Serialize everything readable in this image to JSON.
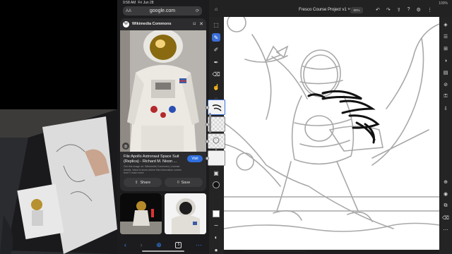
{
  "safari": {
    "status_time": "9:58 AM",
    "status_date": "Fri Jun 28",
    "address": "google.com",
    "address_aa": "AA",
    "source_name": "Wikimedia Commons",
    "result_title": "File:Apollo Astronaut Space Suit (Replica) - Richard M. Nixon ...",
    "result_subtitle": "Get this image on: Wikimedia Commons | License details. Want to know where this information comes from? Learn more",
    "visit_label": "Visit",
    "share_label": "Share",
    "save_label": "Save",
    "tab_count": "5",
    "icons": [
      "back-icon",
      "forward-icon",
      "add-icon",
      "tabs-icon",
      "more-icon"
    ]
  },
  "fresco": {
    "document_title": "Fresco Course Project v1 ˅",
    "zoom_label": "80%",
    "status_right": "100%",
    "accent_color": "#3b6fd6"
  }
}
